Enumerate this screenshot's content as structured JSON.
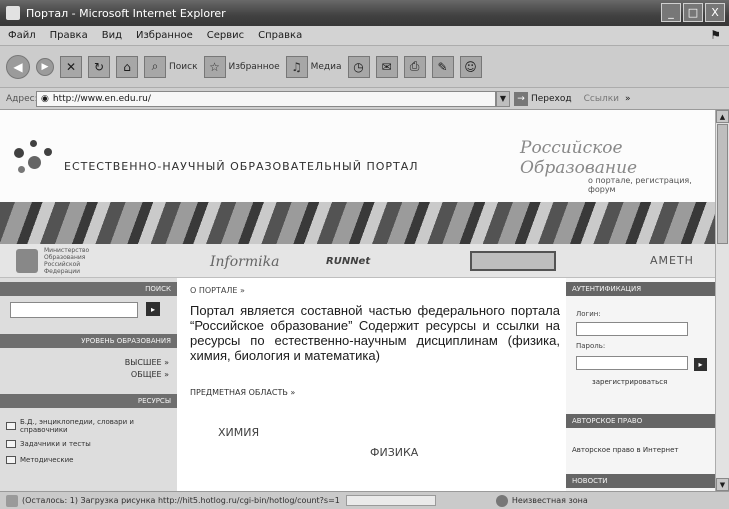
{
  "window": {
    "title": "Портал - Microsoft Internet Explorer",
    "controls": [
      "_",
      "□",
      "X"
    ]
  },
  "menu": {
    "items": [
      "Файл",
      "Правка",
      "Вид",
      "Избранное",
      "Сервис",
      "Справка"
    ]
  },
  "toolbar": {
    "search_label": "Поиск",
    "favorites_label": "Избранное",
    "media_label": "Медиа"
  },
  "address": {
    "label": "Адрес:",
    "url": "http://www.en.edu.ru/",
    "go_label": "Переход",
    "links_label": "Ссылки"
  },
  "header": {
    "site_title": "ЕСТЕСТВЕННО-НАУЧНЫЙ ОБРАЗОВАТЕЛЬНЫЙ ПОРТАЛ",
    "ros_logo": "Российское Образование",
    "ros_link": "о портале, регистрация, форум"
  },
  "partners": {
    "ministry": "Министерство Образования Российской Федерации",
    "informika": "Informika",
    "runnet": "RUNNet",
    "ametn": "АМЕТН"
  },
  "left_sidebar": {
    "search_head": "ПОИСК",
    "search_go": "▸",
    "levels_head": "УРОВЕНЬ ОБРАЗОВАНИЯ",
    "levels": [
      "ВЫСШЕЕ »",
      "ОБЩЕЕ »"
    ],
    "resources_head": "РЕСУРСЫ",
    "resources": [
      "Б.Д., энциклопедии, словари и справочники",
      "Задачники и тесты",
      "Методические"
    ]
  },
  "main": {
    "crumb": "О ПОРТАЛЕ »",
    "intro": "Портал является составной частью федерального портала “Российское образование” Содержит ресурсы и ссылки на ресурсы по естественно-научным дисциплинам (физика, химия, биология и математика)",
    "subject_head": "ПРЕДМЕТНАЯ ОБЛАСТЬ »",
    "subjects": [
      "ХИМИЯ",
      "ФИЗИКА"
    ]
  },
  "right_sidebar": {
    "auth_head": "АУТЕНТИФИКАЦИЯ",
    "login_label": "Логин:",
    "password_label": "Пароль:",
    "go": "▸",
    "register_link": "зарегистрироваться",
    "copyright_head": "АВТОРСКОЕ ПРАВО",
    "copyright_link": "Авторское право в Интернет",
    "news_head": "НОВОСТИ"
  },
  "status": {
    "text": "(Осталось: 1) Загрузка рисунка http://hit5.hotlog.ru/cgi-bin/hotlog/count?s=1",
    "zone": "Неизвестная зона"
  }
}
